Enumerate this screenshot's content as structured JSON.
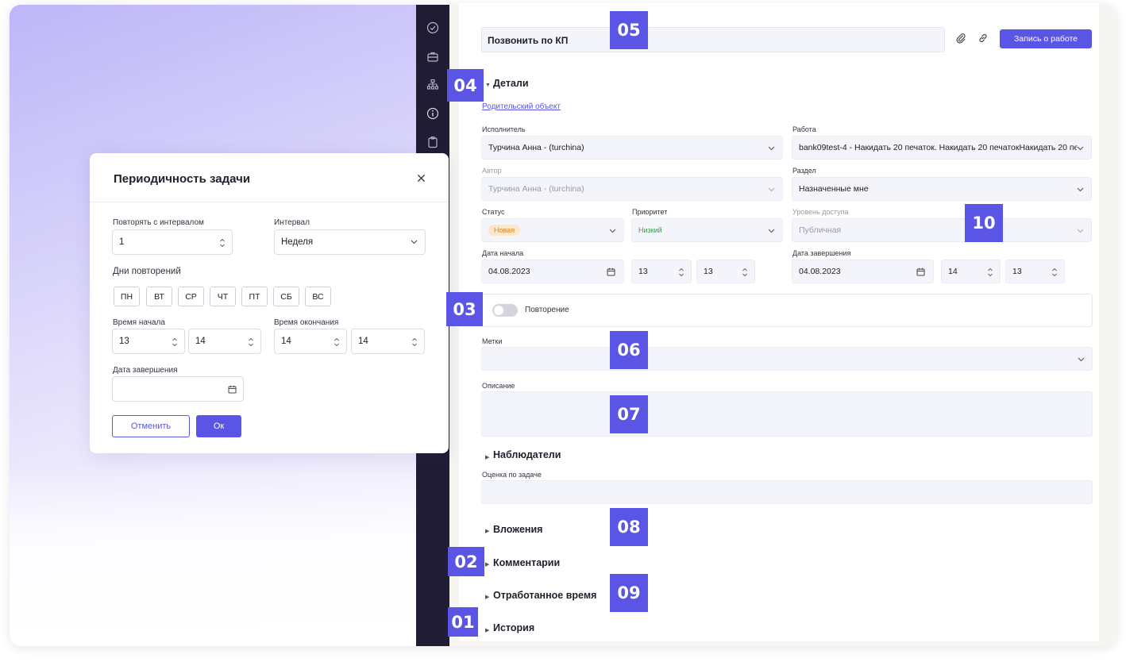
{
  "modal": {
    "title": "Периодичность задачи",
    "close_icon": "close-icon",
    "repeat_interval_label": "Повторять с интервалом",
    "repeat_interval_value": "1",
    "interval_label": "Интервал",
    "interval_value": "Неделя",
    "days_label": "Дни повторений",
    "days": [
      "ПН",
      "ВТ",
      "СР",
      "ЧТ",
      "ПТ",
      "СБ",
      "ВС"
    ],
    "start_time_label": "Время начала",
    "start_hour": "13",
    "start_minute": "14",
    "end_time_label": "Время окончания",
    "end_hour": "14",
    "end_minute": "14",
    "end_date_label": "Дата завершения",
    "end_date_value": "",
    "cancel_label": "Отменить",
    "ok_label": "Ок"
  },
  "task": {
    "title": "Позвонить по КП",
    "work_record_label": "Запись о работе"
  },
  "details": {
    "section_title": "Детали",
    "parent_link": "Родительский объект",
    "assignee_label": "Исполнитель",
    "assignee_value": "Турчина Анна - (turchina)",
    "work_label": "Работа",
    "work_value": "bank09test-4 - Накидать 20 печаток. Накидать 20 печатокНакидать 20 пе",
    "author_label": "Автор",
    "author_value": "Турчина Анна - (turchina)",
    "section_label": "Раздел",
    "section_value": "Назначенные мне",
    "status_label": "Статус",
    "status_value": "Новая",
    "priority_label": "Приоритет",
    "priority_value": "Низкий",
    "access_label": "Уровень доступа",
    "access_value": "Публичная",
    "start_date_label": "Дата начала",
    "start_date_value": "04.08.2023",
    "start_hour": "13",
    "start_minute": "13",
    "end_date_label": "Дата завершения",
    "end_date_value": "04.08.2023",
    "end_hour": "14",
    "end_minute": "13"
  },
  "repeat": {
    "label": "Повторение",
    "enabled": false
  },
  "tags": {
    "label": "Метки",
    "value": ""
  },
  "description": {
    "label": "Описание",
    "value": ""
  },
  "sections": {
    "observers": "Наблюдатели",
    "rating_label": "Оценка по задаче",
    "attachments": "Вложения",
    "comments": "Комментарии",
    "worked_time": "Отработанное время",
    "history": "История"
  },
  "markers": [
    "01",
    "02",
    "03",
    "04",
    "05",
    "06",
    "07",
    "08",
    "09",
    "10"
  ],
  "colors": {
    "accent": "#5b55e6",
    "sidebar": "#1f1c33",
    "status_new_bg": "#fde7c9",
    "status_new_text": "#d6862a",
    "priority_low": "#3c9a52"
  },
  "side_nav_icons": [
    "check-circle-icon",
    "briefcase-icon",
    "org-chart-icon",
    "info-icon",
    "clipboard-icon"
  ]
}
